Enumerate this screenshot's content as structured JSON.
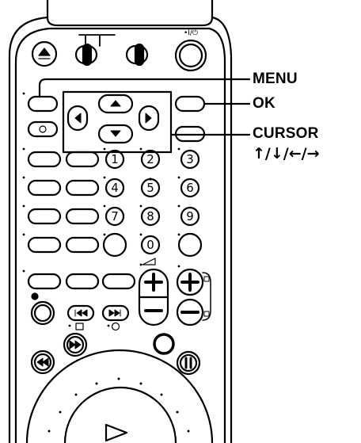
{
  "callouts": {
    "menu": "MENU",
    "ok": "OK",
    "cursor": "CURSOR",
    "cursor_arrows": "↑/↓/←/→"
  },
  "buttons": {
    "digits": [
      "1",
      "2",
      "3",
      "4",
      "5",
      "6",
      "7",
      "8",
      "9",
      "0"
    ],
    "plus": "+",
    "minus": "−",
    "power_label": "•I/⏻",
    "volume_symbol": "◿",
    "eject_symbol": "⏏",
    "rewind_symbol": "◀◀",
    "fast_forward_symbol": "▶▶",
    "prev_symbol": "⏮",
    "next_symbol": "⏭",
    "pause_symbol": "⏸",
    "play_symbol": "▷"
  },
  "colors": {
    "ink": "#000000",
    "body": "#ffffff"
  }
}
